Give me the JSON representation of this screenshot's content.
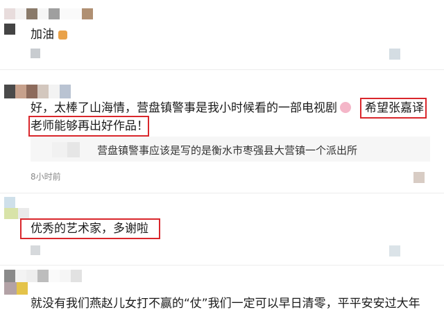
{
  "comments": [
    {
      "text": "加油",
      "emoji": "oil-emoji"
    },
    {
      "text_line1": "好，太棒了山海情，营盘镇警事是我小时候看的一部电视剧",
      "emoji": "pig-emoji",
      "highlight_part1": "希望张嘉译",
      "text_line2": "老师能够再出好作品！",
      "reply": "营盘镇警事应该是写的是衡水市枣强县大营镇一个派出所",
      "time": "8小时前"
    },
    {
      "text": "优秀的艺术家，多谢啦"
    },
    {
      "text": "就没有我们燕赵儿女打不赢的“仗”我们一定可以早日清零，平平安安过大年"
    }
  ],
  "colors": {
    "highlight": "#d9262b",
    "reply_bg": "#f6f6f6"
  }
}
